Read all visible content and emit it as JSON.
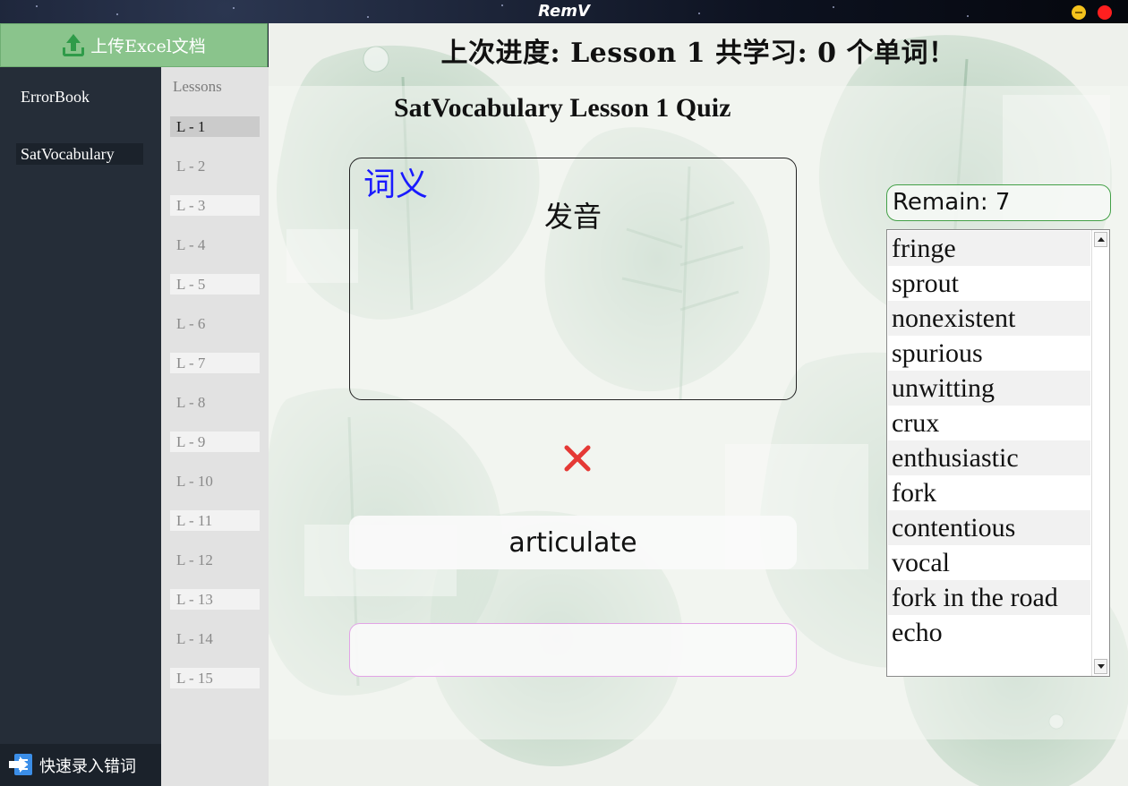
{
  "window": {
    "title": "RemV"
  },
  "sidebar": {
    "upload_label": "上传Excel文档",
    "books": [
      {
        "label": "ErrorBook"
      },
      {
        "label": "SatVocabulary"
      }
    ],
    "quick_entry_label": "快速录入错词"
  },
  "lessons": {
    "header": "Lessons",
    "items": [
      {
        "label": "L - 1"
      },
      {
        "label": "L - 2"
      },
      {
        "label": "L - 3"
      },
      {
        "label": "L - 4"
      },
      {
        "label": "L - 5"
      },
      {
        "label": "L - 6"
      },
      {
        "label": "L - 7"
      },
      {
        "label": "L - 8"
      },
      {
        "label": "L - 9"
      },
      {
        "label": "L - 10"
      },
      {
        "label": "L - 11"
      },
      {
        "label": "L - 12"
      },
      {
        "label": "L - 13"
      },
      {
        "label": "L - 14"
      },
      {
        "label": "L - 15"
      }
    ],
    "selected": "L - 1"
  },
  "main": {
    "progress_title": "上次进度: Lesson 1  共学习: 0 个单词！",
    "quiz_title": "SatVocabulary Lesson 1 Quiz",
    "card": {
      "meaning_label": "词义",
      "pronunciation_label": "发音"
    },
    "result_icon": "wrong-x-icon",
    "answer_display": "articulate",
    "answer_input": {
      "value": "",
      "placeholder": ""
    },
    "remain_label": "Remain: 7",
    "words": [
      "fringe",
      "sprout",
      "nonexistent",
      "spurious",
      "unwitting",
      "crux",
      "enthusiastic",
      "fork",
      "contentious",
      "vocal",
      "fork in the road",
      "echo"
    ]
  },
  "colors": {
    "upload_bg": "#8ac48c",
    "sidebar_bg": "#252d38",
    "meaning_label": "#1a1aff",
    "wrong_mark": "#e53935",
    "remain_border": "#43a047",
    "input_border": "#e2a4e6"
  }
}
